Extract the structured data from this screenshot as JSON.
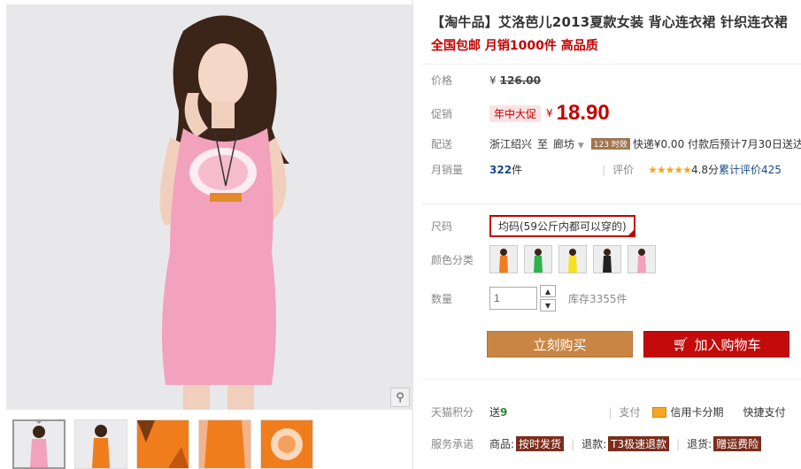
{
  "product": {
    "title": "【淘牛品】艾洛芭儿2013夏款女装 背心连衣裙 针织连衣裙",
    "subtitle": "全国包邮 月销1000件 高品质"
  },
  "price": {
    "label": "价格",
    "currency": "¥",
    "original": "126.00"
  },
  "promo": {
    "label": "促销",
    "badge": "年中大促",
    "currency": "¥",
    "price": "18.90"
  },
  "shipping": {
    "label": "配送",
    "from": "浙江绍兴",
    "to_word": "至",
    "to": "廊坊",
    "badge": "123 时效",
    "fee": "快递¥0.00 付款后预计7月30日送达"
  },
  "sales": {
    "label": "月销量",
    "count": "322",
    "unit": "件",
    "rating_label": "评价",
    "stars": "★★★★★",
    "score": "4.8分",
    "review_text": "累计评价425"
  },
  "size": {
    "label": "尺码",
    "option": "均码(59公斤内都可以穿的)"
  },
  "color": {
    "label": "颜色分类",
    "swatches": [
      "orange-dress",
      "green-dress",
      "yellow-dress",
      "black-dress",
      "pink-dress"
    ]
  },
  "quantity": {
    "label": "数量",
    "value": "1",
    "stock": "库存3355件"
  },
  "actions": {
    "buy": "立刻购买",
    "cart": "加入购物车"
  },
  "points": {
    "label": "天猫积分",
    "text": "送",
    "value": "9",
    "pay_label": "支付",
    "credit": "信用卡分期",
    "quick": "快捷支付"
  },
  "service": {
    "label": "服务承诺",
    "goods": "商品:",
    "goods_tag": "按时发货",
    "refund": "退款:",
    "refund_tag": "T3极速退款",
    "return": "退货:",
    "return_tag": "赠运费险"
  },
  "colors": {
    "accent": "#c40000",
    "buy": "#c88544",
    "cart": "#c30b0b"
  }
}
